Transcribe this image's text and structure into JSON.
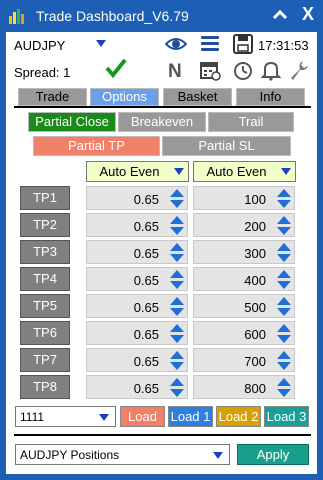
{
  "window": {
    "title": "Trade Dashboard_V6.79",
    "close_glyph": "X"
  },
  "header": {
    "symbol": "AUDJPY",
    "spread_label": "Spread: 1",
    "clock": "17:31:53",
    "icons": [
      "eye-icon",
      "list-icon",
      "save-icon",
      "news-icon",
      "calendar-icon",
      "timer-icon",
      "bell-icon",
      "wrench-icon",
      "checkmark-icon"
    ]
  },
  "tabs": [
    {
      "label": "Trade",
      "active": false
    },
    {
      "label": "Options",
      "active": true
    },
    {
      "label": "Basket",
      "active": false
    },
    {
      "label": "Info",
      "active": false
    }
  ],
  "options": {
    "modes": [
      "Partial Close",
      "Breakeven",
      "Trail"
    ],
    "partial_tabs": [
      "Partial TP",
      "Partial SL"
    ],
    "auto_even_left": "Auto Even",
    "auto_even_right": "Auto Even"
  },
  "tp_rows": [
    {
      "label": "TP1",
      "lots": "0.65",
      "points": "100"
    },
    {
      "label": "TP2",
      "lots": "0.65",
      "points": "200"
    },
    {
      "label": "TP3",
      "lots": "0.65",
      "points": "300"
    },
    {
      "label": "TP4",
      "lots": "0.65",
      "points": "400"
    },
    {
      "label": "TP5",
      "lots": "0.65",
      "points": "500"
    },
    {
      "label": "TP6",
      "lots": "0.65",
      "points": "600"
    },
    {
      "label": "TP7",
      "lots": "0.65",
      "points": "700"
    },
    {
      "label": "TP8",
      "lots": "0.65",
      "points": "800"
    }
  ],
  "presets": {
    "selected": "1111",
    "load": "Load",
    "load1": "Load 1",
    "load2": "Load 2",
    "load3": "Load 3"
  },
  "positions": {
    "selected": "AUDJPY Positions",
    "apply": "Apply"
  },
  "colors": {
    "titlebar": "#1d5fb4",
    "active_tab": "#6aa0e6",
    "partial_close": "#1a8a1a",
    "partial_tp": "#f08068",
    "auto_even_bg": "#f0ffc8",
    "arrow_blue": "#1f6fd6",
    "apply": "#1aa08a"
  }
}
